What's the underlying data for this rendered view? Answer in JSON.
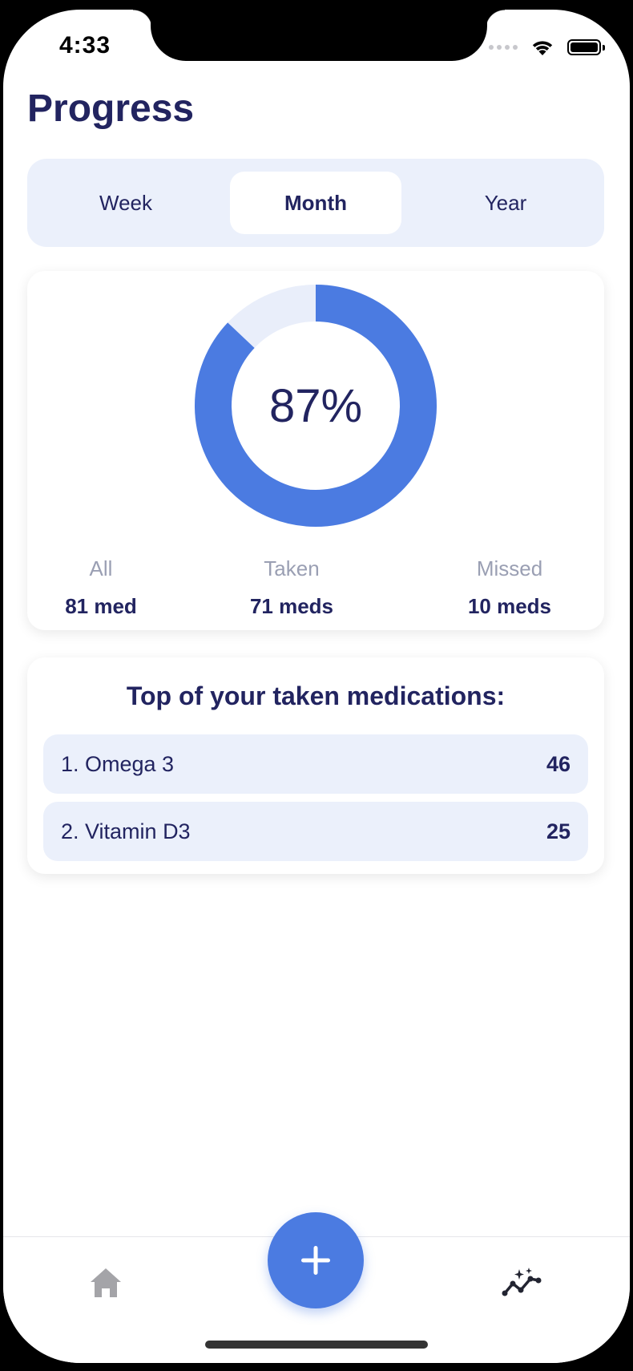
{
  "status_bar": {
    "time": "4:33"
  },
  "header": {
    "title": "Progress"
  },
  "period_tabs": {
    "selected": "Month",
    "items": [
      {
        "label": "Week"
      },
      {
        "label": "Month"
      },
      {
        "label": "Year"
      }
    ]
  },
  "summary": {
    "percent": 0.87,
    "percent_label": "87%",
    "colors": {
      "taken": "#4b7be1",
      "missed": "#e9eefa",
      "text": "#222460"
    },
    "stats": [
      {
        "label": "All",
        "value": "81 med"
      },
      {
        "label": "Taken",
        "value": "71 meds"
      },
      {
        "label": "Missed",
        "value": "10 meds"
      }
    ]
  },
  "top_meds": {
    "title": "Top of your taken medications:",
    "items": [
      {
        "name": "1. Omega 3",
        "count": "46"
      },
      {
        "name": "2. Vitamin D3",
        "count": "25"
      }
    ]
  },
  "tab_bar": {
    "icons": [
      "home-icon",
      "add-icon",
      "stats-icon"
    ]
  }
}
